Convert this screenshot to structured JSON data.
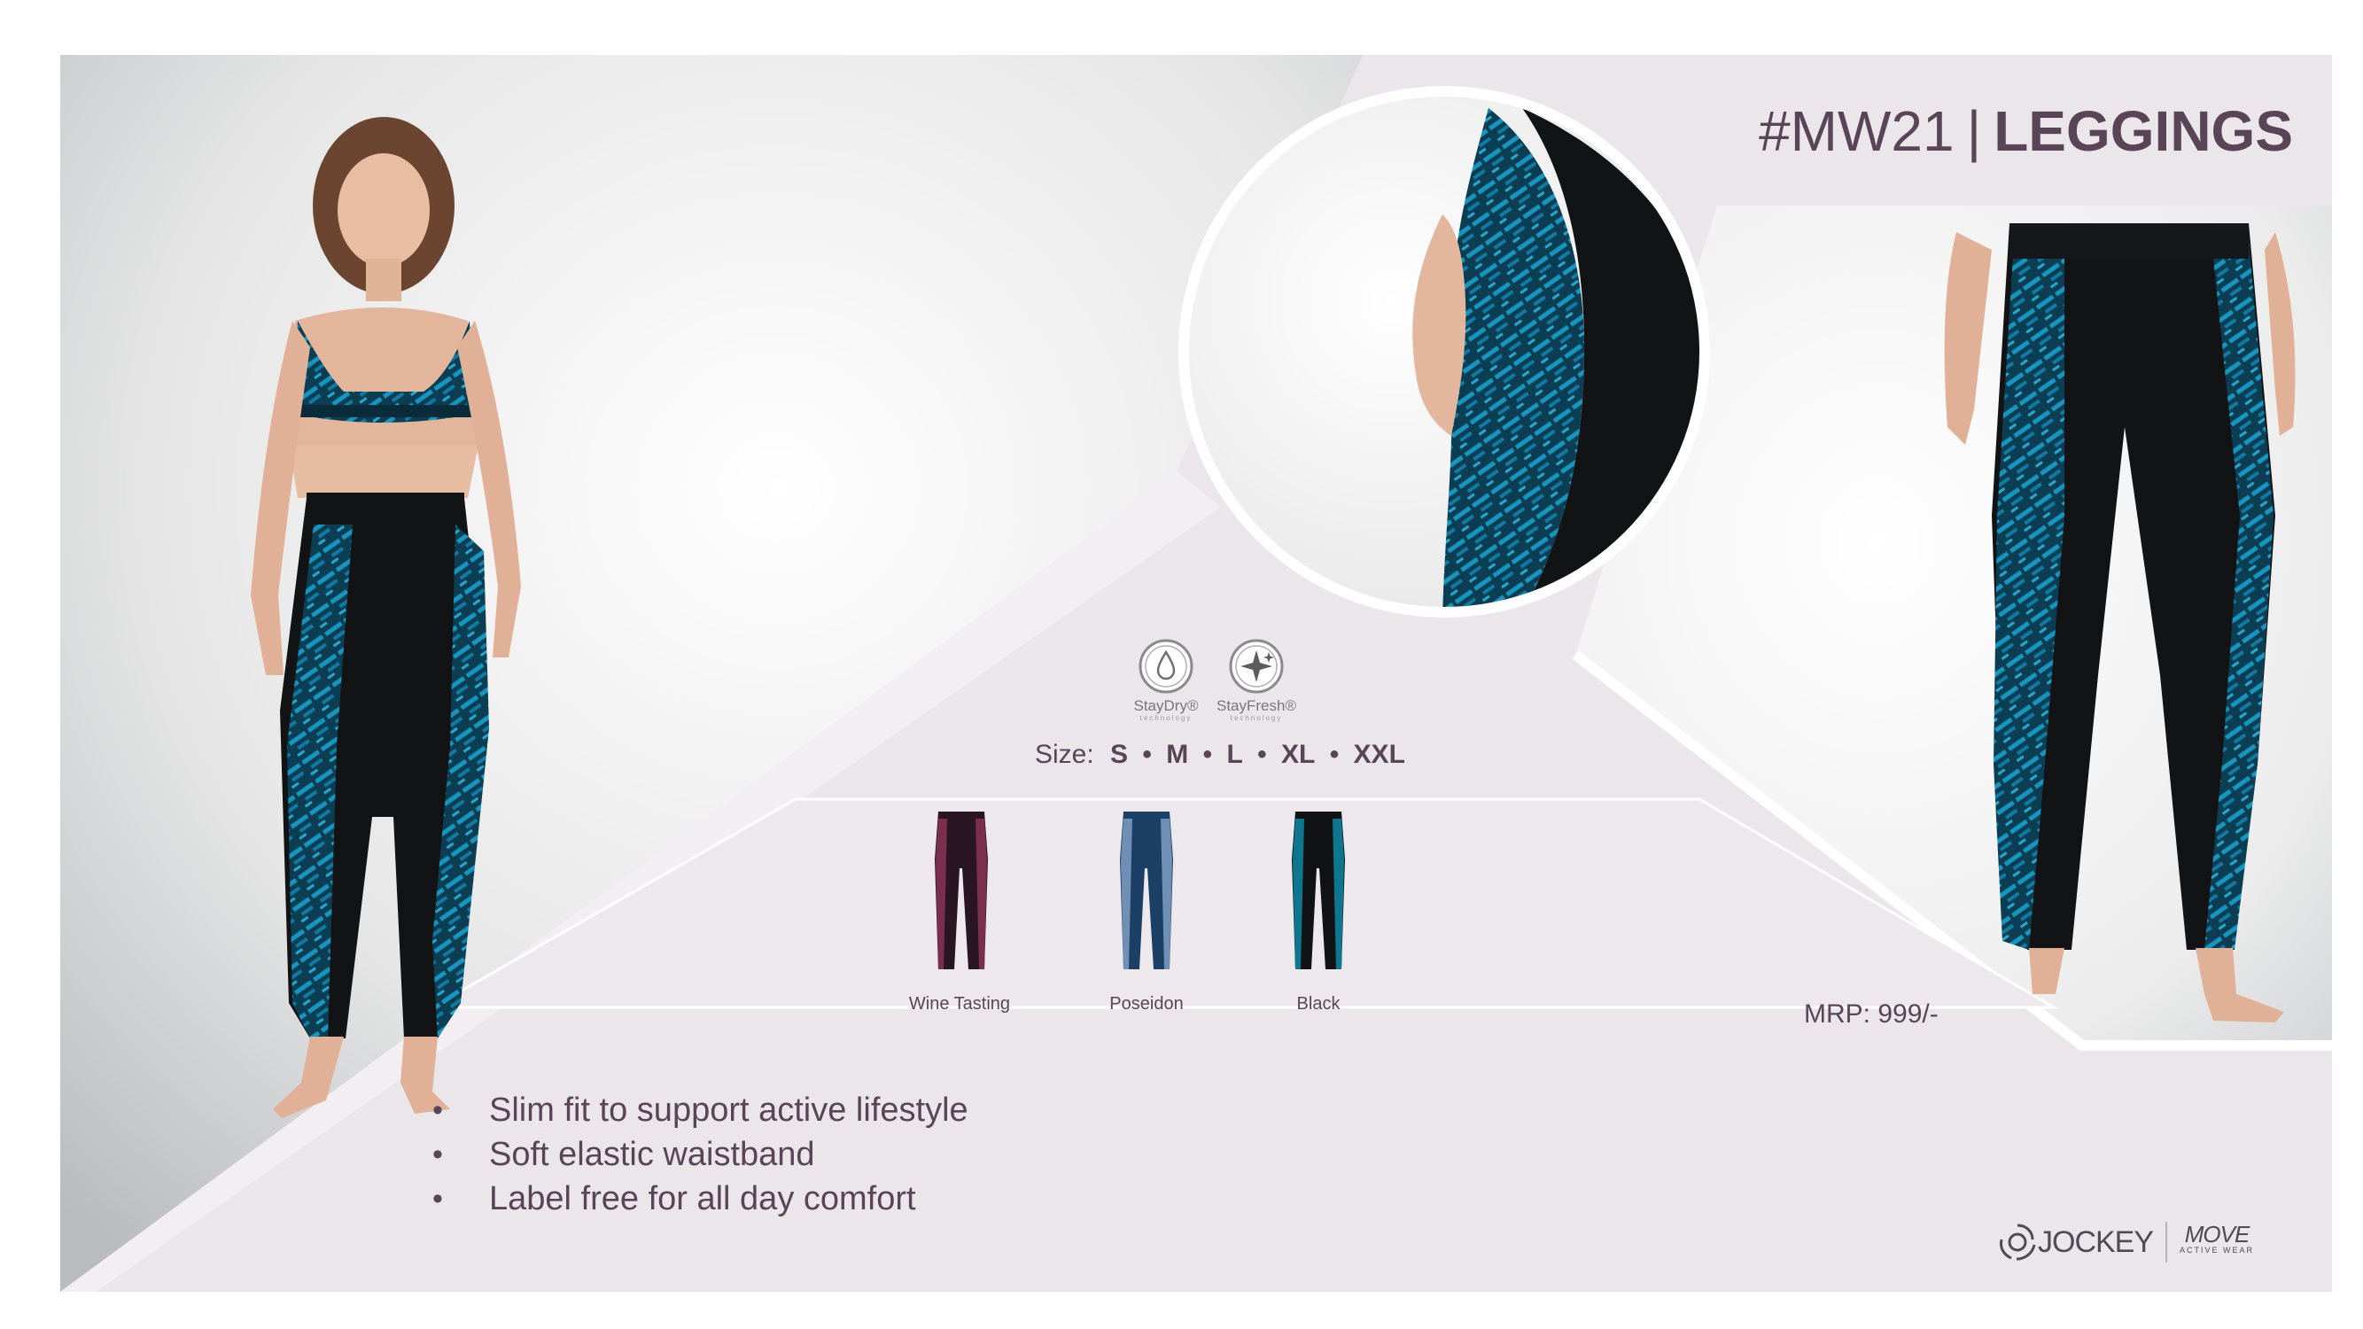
{
  "product": {
    "code": "#MW21",
    "separator": "|",
    "name": "LEGGINGS"
  },
  "technologies": [
    {
      "icon": "droplet-icon",
      "name": "StayDry®",
      "sub": "technology"
    },
    {
      "icon": "sparkle-icon",
      "name": "StayFresh®",
      "sub": "technology"
    }
  ],
  "size": {
    "label": "Size:",
    "options": [
      "S",
      "M",
      "L",
      "XL",
      "XXL"
    ]
  },
  "colors": [
    {
      "name": "Wine Tasting",
      "base": "#2a1622",
      "accent": "#7a2f4c"
    },
    {
      "name": "Poseidon",
      "base": "#1c3f66",
      "accent": "#6f8fb4"
    },
    {
      "name": "Black",
      "base": "#101214",
      "accent": "#0f7690"
    }
  ],
  "price": "MRP: 999/-",
  "features": [
    "Slim fit to support active lifestyle",
    "Soft elastic waistband",
    "Label free for all day comfort"
  ],
  "brand": {
    "name": "JOCKEY",
    "sub_brand": "MOVE",
    "sub_brand_tagline": "ACTIVE WEAR"
  },
  "palette": {
    "panel": "#ebe6ea",
    "text": "#5a4457",
    "print_blue": "#0e7a9b",
    "fabric_black": "#121315"
  }
}
